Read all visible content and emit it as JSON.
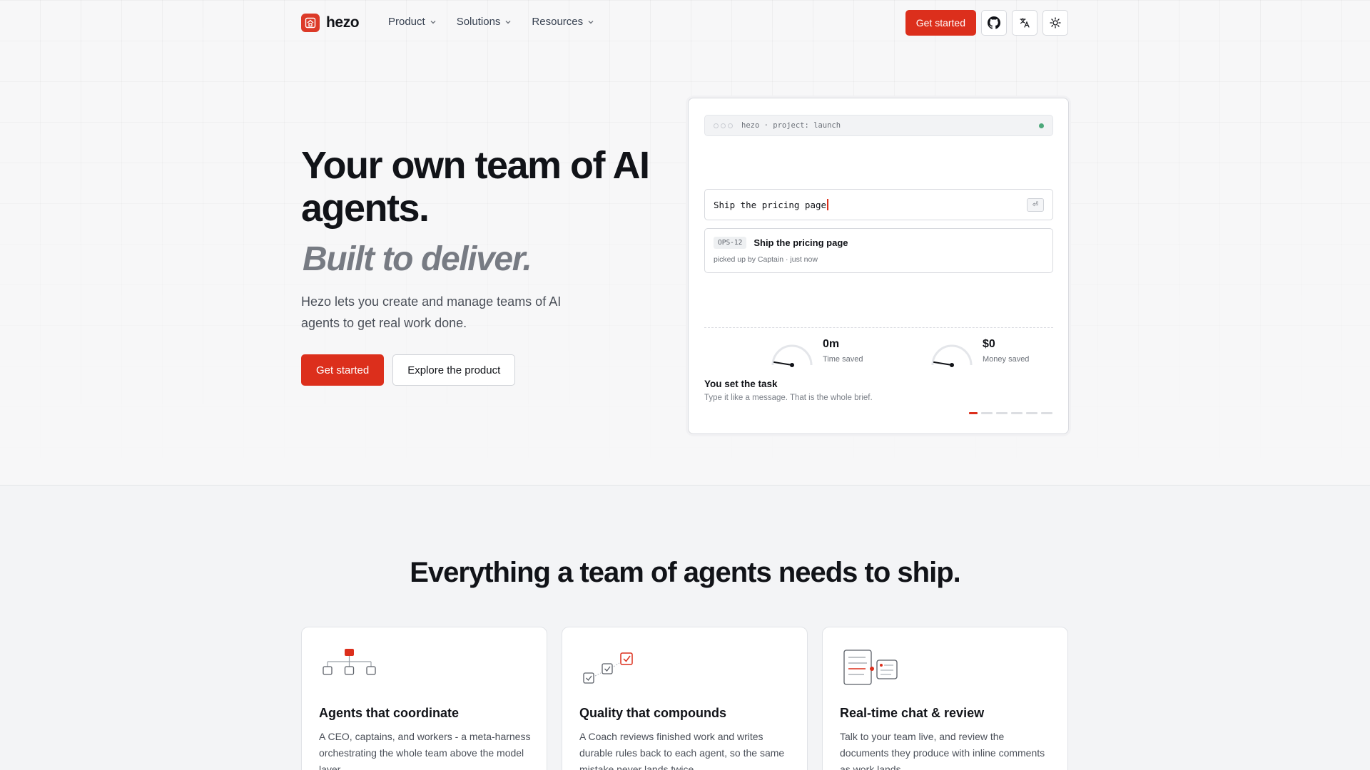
{
  "nav": {
    "logo_text": "hezo",
    "links": [
      {
        "label": "Product"
      },
      {
        "label": "Solutions"
      },
      {
        "label": "Resources"
      }
    ],
    "cta_label": "Get started",
    "icons": [
      "github-icon",
      "translate-icon",
      "sun-icon"
    ]
  },
  "hero": {
    "title": "Your own team of AI agents.",
    "subtitle": "Built to deliver.",
    "description": "Hezo lets you create and manage teams of AI agents to get real work done.",
    "primary_button": "Get started",
    "secondary_button": "Explore the product"
  },
  "demo": {
    "terminal_title": "hezo · project: launch",
    "input_value": "Ship the pricing page",
    "enter_key": "⏎",
    "ticket": {
      "id": "OPS-12",
      "title": "Ship the pricing page",
      "meta": "picked up by Captain · just now"
    },
    "metrics": [
      {
        "value": "0m",
        "label": "Time saved"
      },
      {
        "value": "$0",
        "label": "Money saved"
      }
    ],
    "step_title": "You set the task",
    "step_description": "Type it like a message. That is the whole brief.",
    "steps_total": 6,
    "step_active": 1,
    "colors": {
      "accent": "#dc2f1c",
      "status": "#4ca87a"
    }
  },
  "features_section": {
    "title": "Everything a team of agents needs to ship.",
    "cards": [
      {
        "icon": "org-chart-icon",
        "title": "Agents that coordinate",
        "description": "A CEO, captains, and workers - a meta-harness orchestrating the whole team above the model layer."
      },
      {
        "icon": "checklist-icon",
        "title": "Quality that compounds",
        "description": "A Coach reviews finished work and writes durable rules back to each agent, so the same mistake never lands twice."
      },
      {
        "icon": "document-review-icon",
        "title": "Real-time chat & review",
        "description": "Talk to your team live, and review the documents they produce with inline comments as work lands."
      }
    ]
  },
  "colors": {
    "brand": "#dc2f1c",
    "text": "#111318",
    "muted": "#777b83"
  }
}
